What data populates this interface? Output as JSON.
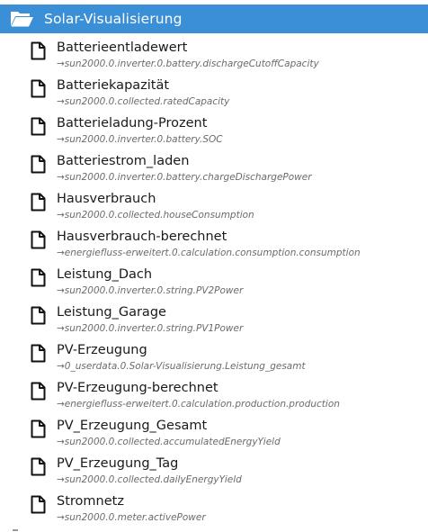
{
  "folder": {
    "title": "Solar-Visualisierung",
    "icon": "folder-open-icon",
    "color": "#3a8fd6"
  },
  "items": [
    {
      "name": "Batterieentladewert",
      "path": "→sun2000.0.inverter.0.battery.dischargeCutoffCapacity",
      "icon": "file-icon"
    },
    {
      "name": "Batteriekapazität",
      "path": "→sun2000.0.collected.ratedCapacity",
      "icon": "file-icon"
    },
    {
      "name": "Batterieladung-Prozent",
      "path": "→sun2000.0.inverter.0.battery.SOC",
      "icon": "file-icon"
    },
    {
      "name": "Batteriestrom_laden",
      "path": "→sun2000.0.inverter.0.battery.chargeDischargePower",
      "icon": "file-icon"
    },
    {
      "name": "Hausverbrauch",
      "path": "→sun2000.0.collected.houseConsumption",
      "icon": "file-icon"
    },
    {
      "name": "Hausverbrauch-berechnet",
      "path": "→energiefluss-erweitert.0.calculation.consumption.consumption",
      "icon": "file-icon"
    },
    {
      "name": "Leistung_Dach",
      "path": "→sun2000.0.inverter.0.string.PV2Power",
      "icon": "file-icon"
    },
    {
      "name": "Leistung_Garage",
      "path": "→sun2000.0.inverter.0.string.PV1Power",
      "icon": "file-icon"
    },
    {
      "name": "PV-Erzeugung",
      "path": "→0_userdata.0.Solar-Visualisierung.Leistung_gesamt",
      "icon": "file-icon"
    },
    {
      "name": "PV-Erzeugung-berechnet",
      "path": "→energiefluss-erweitert.0.calculation.production.production",
      "icon": "file-icon"
    },
    {
      "name": "PV_Erzeugung_Gesamt",
      "path": "→sun2000.0.collected.accumulatedEnergyYield",
      "icon": "file-icon"
    },
    {
      "name": "PV_Erzeugung_Tag",
      "path": "→sun2000.0.collected.dailyEnergyYield",
      "icon": "file-icon"
    },
    {
      "name": "Stromnetz",
      "path": "→sun2000.0.meter.activePower",
      "icon": "file-icon"
    }
  ]
}
